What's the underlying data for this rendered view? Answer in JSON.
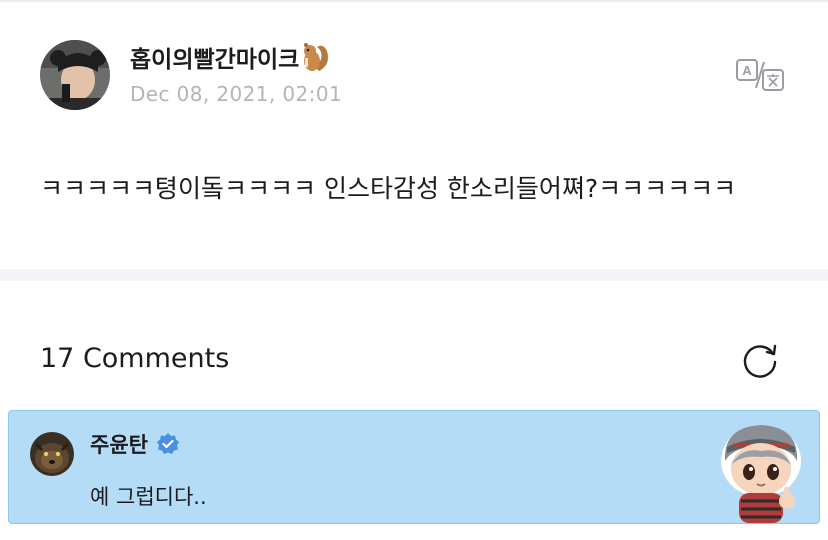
{
  "post": {
    "author": "홉이의빨간마이크",
    "author_emoji_icon": "chipmunk-icon",
    "date": "Dec 08, 2021, 02:01",
    "translate_icon": "translate-icon",
    "body": "ㅋㅋㅋㅋㅋ텽이돜ㅋㅋㅋㅋ 인스타감성 한소리들어쪄?ㅋㅋㅋㅋㅋㅋ"
  },
  "comments": {
    "count_label": "17 Comments",
    "refresh_icon": "refresh-icon",
    "items": [
      {
        "name": "주윤탄",
        "verified_icon": "verified-badge-icon",
        "text": "예 그럽디다..",
        "highlight_color": "#b5dcf6"
      }
    ]
  },
  "colors": {
    "text": "#1c1c1e",
    "date": "#b4b4bd",
    "divider": "#f4f4f8",
    "comment_highlight": "#b5dcf6",
    "verified": "#4a90e2"
  }
}
